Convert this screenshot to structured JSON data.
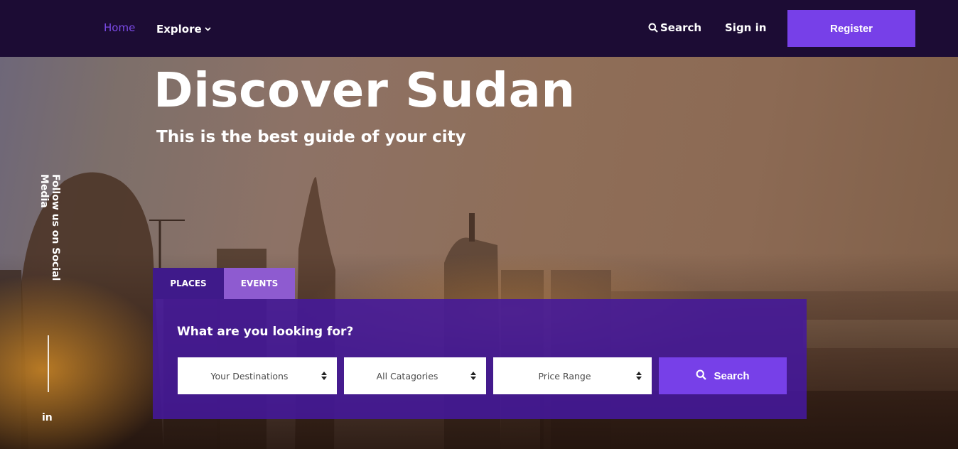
{
  "nav": {
    "home": "Home",
    "explore": "Explore",
    "search": "Search",
    "signin": "Sign in",
    "register": "Register"
  },
  "hero": {
    "title": "Discover Sudan",
    "subtitle": "This is the best guide of your city"
  },
  "social": {
    "label": "Follow us on Social Media",
    "linkedin": "in"
  },
  "tabs": [
    {
      "label": "PLACES"
    },
    {
      "label": "EVENTS"
    }
  ],
  "search_panel": {
    "title": "What are you looking for?",
    "destinations": "Your Destinations",
    "categories": "All Catagories",
    "price_range": "Price Range",
    "button": "Search"
  },
  "colors": {
    "navbar_bg": "#1c0c34",
    "accent": "#7740e8",
    "active_nav": "#7b4ae6",
    "panel_bg": "#44189c"
  }
}
